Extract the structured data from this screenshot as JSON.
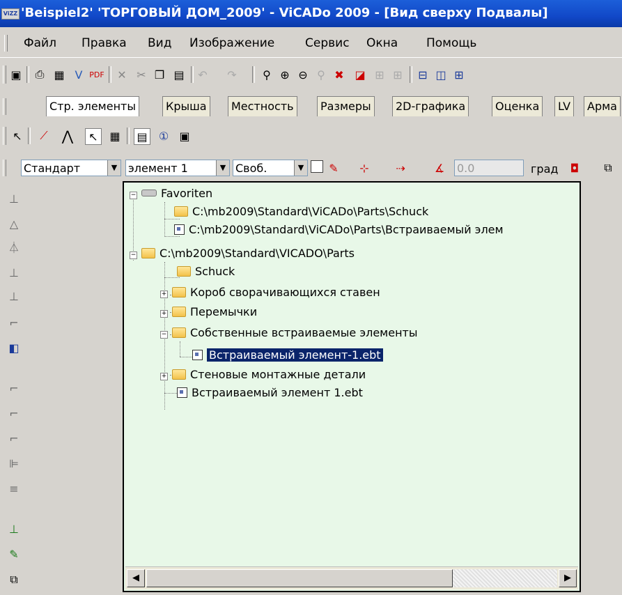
{
  "window": {
    "title": "'Beispiel2' 'ТОРГОВЫЙ ДОМ_2009' - ViCADo 2009 - [Вид сверху Подвалы]",
    "logo_text": "ViZZ"
  },
  "menu": [
    "Файл",
    "Правка",
    "Вид",
    "Изображение",
    "Сервис",
    "Окна",
    "Помощь"
  ],
  "tabs": [
    "Стр. элементы",
    "Крыша",
    "Местность",
    "Размеры",
    "2D-графика",
    "Оценка",
    "LV",
    "Арма"
  ],
  "combos": {
    "style": "Стандарт",
    "element": "элемент 1",
    "mode": "Своб.",
    "angle_value": "0.0",
    "angle_unit": "град"
  },
  "tree": [
    {
      "label": "Favoriten",
      "icon": "drive-icon",
      "expander": "−"
    },
    {
      "label": "C:\\mb2009\\Standard\\ViCADo\\Parts\\Schuck",
      "icon": "folder-icon",
      "expander": ""
    },
    {
      "label": "C:\\mb2009\\Standard\\ViCADo\\Parts\\Встраиваемый элем",
      "icon": "file-icon",
      "expander": ""
    },
    {
      "label": "C:\\mb2009\\Standard\\VICADO\\Parts",
      "icon": "folder-icon",
      "expander": "−"
    },
    {
      "label": "Schuck",
      "icon": "folder-icon",
      "expander": ""
    },
    {
      "label": "Короб сворачивающихся ставен",
      "icon": "folder-icon",
      "expander": "+"
    },
    {
      "label": "Перемычки",
      "icon": "folder-icon",
      "expander": "+"
    },
    {
      "label": "Собственные встраиваемые элементы",
      "icon": "folder-icon",
      "expander": "−"
    },
    {
      "label": "Встраиваемый элемент-1.ebt",
      "icon": "file-icon",
      "expander": "",
      "selected": true
    },
    {
      "label": "Стеновые монтажные детали",
      "icon": "folder-icon",
      "expander": "+"
    },
    {
      "label": "Встраиваемый элемент 1.ebt",
      "icon": "file-icon",
      "expander": ""
    }
  ],
  "scroll": {
    "left_arrow": "◀",
    "right_arrow": "▶"
  },
  "colors": {
    "title_bar": "#1148c8",
    "panel_bg": "#e8f8e8",
    "selection": "#0a246a"
  }
}
